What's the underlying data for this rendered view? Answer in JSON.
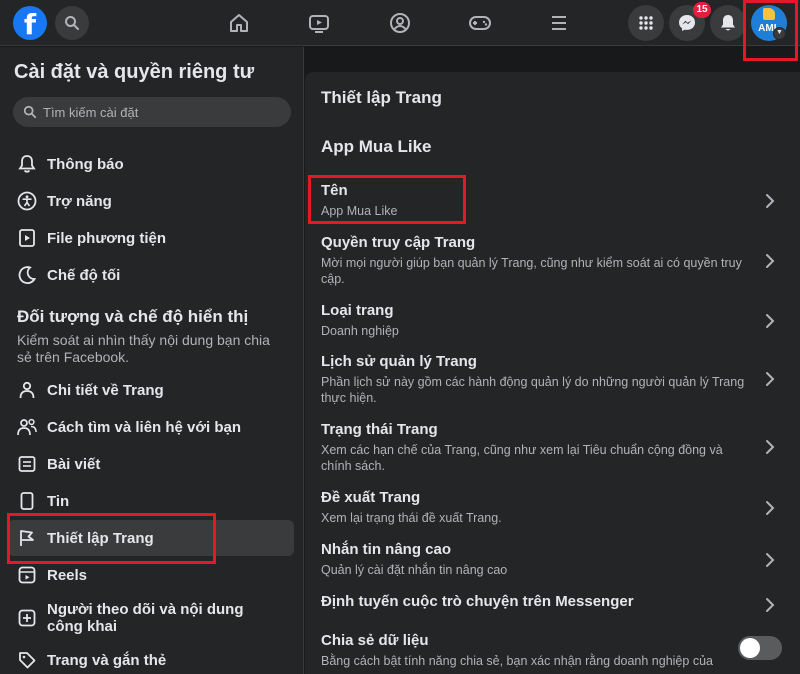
{
  "topbar": {
    "logo_letter": "f",
    "notification_count": "15",
    "avatar_text": "AML"
  },
  "sidebar": {
    "title": "Cài đặt và quyền riêng tư",
    "search_placeholder": "Tìm kiếm cài đặt",
    "items_top": [
      {
        "label": "Thông báo",
        "icon": "bell-icon"
      },
      {
        "label": "Trợ năng",
        "icon": "accessibility-icon"
      },
      {
        "label": "File phương tiện",
        "icon": "media-file-icon"
      },
      {
        "label": "Chế độ tối",
        "icon": "moon-icon"
      }
    ],
    "section_title": "Đối tượng và chế độ hiển thị",
    "section_desc": "Kiểm soát ai nhìn thấy nội dung bạn chia sẻ trên Facebook.",
    "items_bottom": [
      {
        "label": "Chi tiết về Trang",
        "icon": "page-info-icon"
      },
      {
        "label": "Cách tìm và liên hệ với bạn",
        "icon": "people-icon"
      },
      {
        "label": "Bài viết",
        "icon": "post-icon"
      },
      {
        "label": "Tin",
        "icon": "story-icon"
      },
      {
        "label": "Thiết lập Trang",
        "icon": "flag-icon",
        "active": true
      },
      {
        "label": "Reels",
        "icon": "reels-icon"
      },
      {
        "label": "Người theo dõi và nội dung công khai",
        "icon": "followers-icon"
      },
      {
        "label": "Trang và gắn thẻ",
        "icon": "tag-icon"
      }
    ]
  },
  "main": {
    "title": "Thiết lập Trang",
    "page_name": "App Mua Like",
    "rows": [
      {
        "title": "Tên",
        "desc": "App Mua Like"
      },
      {
        "title": "Quyền truy cập Trang",
        "desc": "Mời mọi người giúp bạn quản lý Trang, cũng như kiểm soát ai có quyền truy cập."
      },
      {
        "title": "Loại trang",
        "desc": "Doanh nghiệp"
      },
      {
        "title": "Lịch sử quản lý Trang",
        "desc": "Phần lịch sử này gồm các hành động quản lý do những người quản lý Trang thực hiện."
      },
      {
        "title": "Trạng thái Trang",
        "desc": "Xem các hạn chế của Trang, cũng như xem lại Tiêu chuẩn cộng đồng và chính sách."
      },
      {
        "title": "Đề xuất Trang",
        "desc": "Xem lại trạng thái đề xuất Trang."
      },
      {
        "title": "Nhắn tin nâng cao",
        "desc": "Quản lý cài đặt nhắn tin nâng cao"
      },
      {
        "title": "Định tuyến cuộc trò chuyện trên Messenger",
        "desc": ""
      },
      {
        "title": "Chia sẻ dữ liệu",
        "desc": "Bằng cách bật tính năng chia sẻ, bạn xác nhận rằng doanh nghiệp của"
      }
    ],
    "data_sharing_enabled": false
  },
  "colors": {
    "background": "#18191a",
    "surface": "#242526",
    "accent": "#1877f2",
    "highlight_box": "#e3192a"
  }
}
